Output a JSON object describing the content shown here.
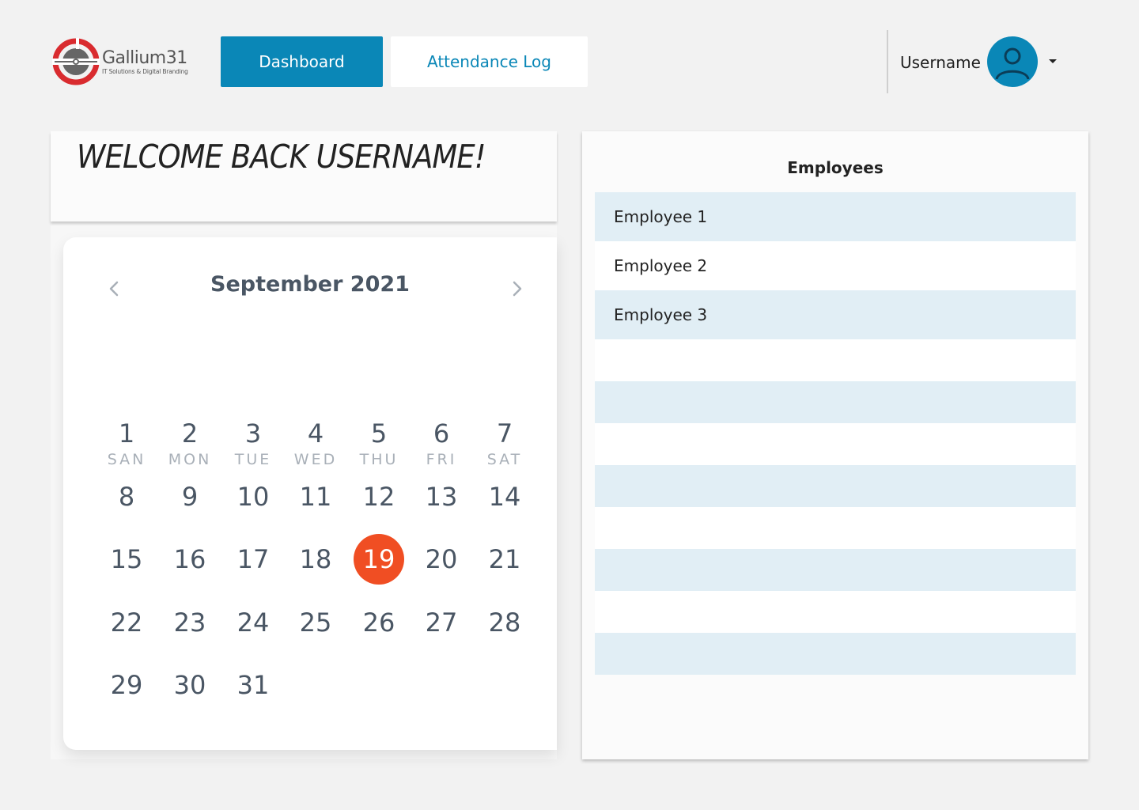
{
  "header": {
    "logo": {
      "name": "Gallium31",
      "tagline": "IT Solutions & Digital Branding"
    },
    "nav": [
      {
        "label": "Dashboard",
        "active": true
      },
      {
        "label": "Attendance Log",
        "active": false
      }
    ],
    "user": {
      "name": "Username",
      "avatar_icon": "user-icon",
      "menu_icon": "caret-down-icon"
    }
  },
  "welcome": {
    "text": "WELCOME BACK USERNAME!"
  },
  "calendar": {
    "month_label": "September 2021",
    "prev_icon": "chevron-left-icon",
    "next_icon": "chevron-right-icon",
    "weekdays": [
      "SAN",
      "MON",
      "TUE",
      "WED",
      "THU",
      "FRI",
      "SAT"
    ],
    "days": [
      "1",
      "2",
      "3",
      "4",
      "5",
      "6",
      "7",
      "8",
      "9",
      "10",
      "11",
      "12",
      "13",
      "14",
      "15",
      "16",
      "17",
      "18",
      "19",
      "20",
      "21",
      "22",
      "23",
      "24",
      "25",
      "26",
      "27",
      "28",
      "29",
      "30",
      "31"
    ],
    "selected_day": "19",
    "first_weekday_index": 0
  },
  "employees": {
    "title": "Employees",
    "rows": [
      "Employee 1",
      "Employee 2",
      "Employee 3",
      "",
      "",
      "",
      "",
      "",
      "",
      "",
      ""
    ]
  },
  "colors": {
    "primary": "#0a87b7",
    "accent": "#f04e23",
    "row_shade": "#e1eef5",
    "background": "#f2f2f2"
  }
}
